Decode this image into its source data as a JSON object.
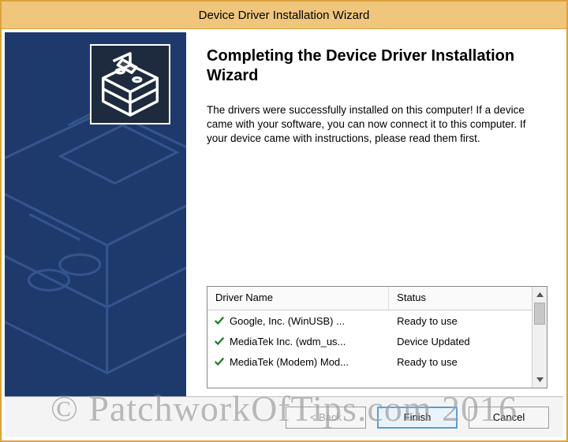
{
  "window": {
    "title": "Device Driver Installation Wizard"
  },
  "content": {
    "heading": "Completing the Device Driver Installation Wizard",
    "body": "The drivers were successfully installed on this computer! If a device came with your software, you can now connect it to this computer. If your device came with instructions, please read them first."
  },
  "table": {
    "headers": {
      "name": "Driver Name",
      "status": "Status"
    },
    "rows": [
      {
        "name": "Google, Inc. (WinUSB) ...",
        "status": "Ready to use"
      },
      {
        "name": "MediaTek Inc. (wdm_us...",
        "status": "Device Updated"
      },
      {
        "name": "MediaTek (Modem) Mod...",
        "status": "Ready to use"
      }
    ]
  },
  "buttons": {
    "back": "< Back",
    "finish": "Finish",
    "cancel": "Cancel"
  },
  "watermark": "© PatchworkOfTips.com 2016"
}
